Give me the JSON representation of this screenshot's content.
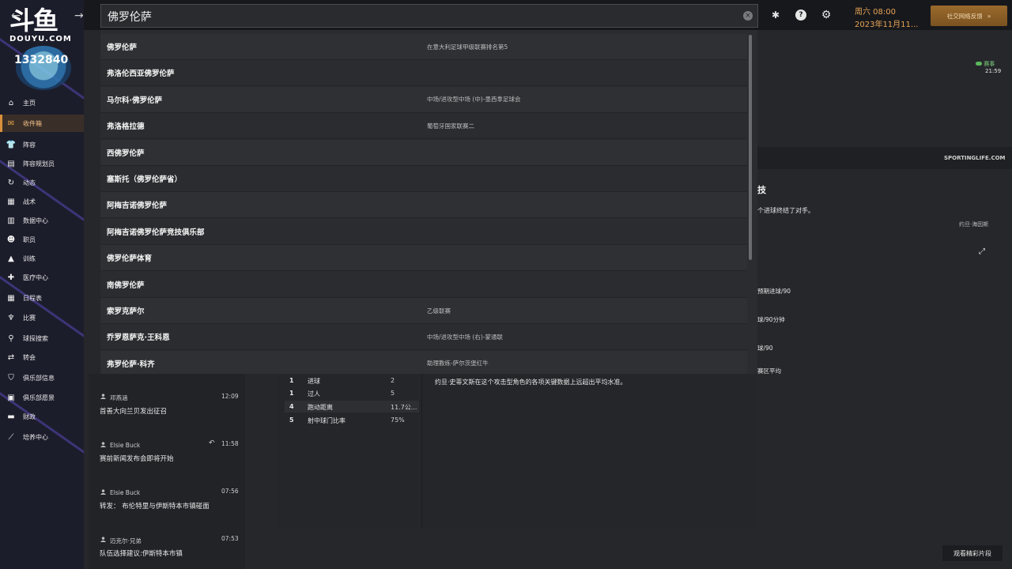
{
  "brand": {
    "logo_text": "斗鱼",
    "logo_sub": "DOUYU.COM",
    "room_number": "1332840"
  },
  "sidebar": {
    "items": [
      {
        "label": "主页",
        "icon": "home-icon",
        "glyph": "⌂"
      },
      {
        "label": "收件箱",
        "icon": "inbox-icon",
        "glyph": "✉",
        "active": true
      },
      {
        "label": "阵容",
        "icon": "shirt-icon",
        "glyph": "👕"
      },
      {
        "label": "阵容规划员",
        "icon": "clipboard-icon",
        "glyph": "▤"
      },
      {
        "label": "动态",
        "icon": "refresh-icon",
        "glyph": "↻"
      },
      {
        "label": "战术",
        "icon": "tactics-icon",
        "glyph": "▦"
      },
      {
        "label": "数据中心",
        "icon": "data-icon",
        "glyph": "▥"
      },
      {
        "label": "职员",
        "icon": "staff-icon",
        "glyph": "☻"
      },
      {
        "label": "训练",
        "icon": "training-icon",
        "glyph": "▲"
      },
      {
        "label": "医疗中心",
        "icon": "medical-icon",
        "glyph": "✚"
      },
      {
        "label": "日程表",
        "icon": "calendar-icon",
        "glyph": "▦"
      },
      {
        "label": "比赛",
        "icon": "trophy-icon",
        "glyph": "♆"
      },
      {
        "label": "球探搜索",
        "icon": "search-icon",
        "glyph": "⚲"
      },
      {
        "label": "转会",
        "icon": "transfer-icon",
        "glyph": "⇄"
      },
      {
        "label": "俱乐部信息",
        "icon": "shield-icon",
        "glyph": "⛉"
      },
      {
        "label": "俱乐部愿景",
        "icon": "vision-icon",
        "glyph": "▣"
      },
      {
        "label": "财政",
        "icon": "finance-icon",
        "glyph": "▬"
      },
      {
        "label": "培养中心",
        "icon": "development-icon",
        "glyph": "⟋"
      }
    ]
  },
  "search": {
    "value": "佛罗伦萨",
    "results": [
      {
        "name": "佛罗伦萨",
        "desc": "在意大利足球甲级联赛排名第5"
      },
      {
        "name": "弗洛伦西亚佛罗伦萨",
        "desc": ""
      },
      {
        "name": "马尔科·佛罗伦萨",
        "desc": "中场/进攻型中场 (中)-墨西拿足球会"
      },
      {
        "name": "弗洛格拉德",
        "desc": "葡萄牙国家联赛二"
      },
      {
        "name": "西佛罗伦萨",
        "desc": ""
      },
      {
        "name": "塞斯托（佛罗伦萨省）",
        "desc": ""
      },
      {
        "name": "阿梅吉诺佛罗伦萨",
        "desc": ""
      },
      {
        "name": "阿梅吉诺佛罗伦萨竞技俱乐部",
        "desc": ""
      },
      {
        "name": "佛罗伦萨体育",
        "desc": ""
      },
      {
        "name": "南佛罗伦萨",
        "desc": ""
      },
      {
        "name": "索罗克萨尔",
        "desc": "乙级联赛"
      },
      {
        "name": "乔罗恩萨克·王科恩",
        "desc": "中场/进攻型中场 (右)-蒙通联"
      },
      {
        "name": "弗罗伦萨·科齐",
        "desc": "助理教练-萨尔茨堡红牛"
      }
    ]
  },
  "topbar": {
    "date_line1": "周六 08:00",
    "date_line2": "2023年11月11...",
    "social_button": "社交网络反馈",
    "social_chevron": "»"
  },
  "right_panel": {
    "match_label": "赛事",
    "match_time": "21:59",
    "source": "SPORTINGLIFE.COM",
    "headline_tail": "技",
    "summary_tail": "个进球终结了对手。",
    "author": "约旦·海因斯",
    "stats_labels": [
      "预期进球/90",
      "球/90分钟",
      "球/90",
      "赛区平均"
    ],
    "expand_icon": "⤢"
  },
  "messages": [
    {
      "sender": "邓燕涵",
      "time": "12:09",
      "text": "首善大向兰贝发出征召",
      "reply": false
    },
    {
      "sender": "Elsie Buck",
      "time": "11:58",
      "text": "赛前新闻发布会即将开始",
      "reply": true
    },
    {
      "sender": "Elsie Buck",
      "time": "07:56",
      "text": "转发： 布伦特里与伊斯特本市镇碰面",
      "reply": false
    },
    {
      "sender": "迈克尔·兄弟",
      "time": "07:53",
      "text": "队伍选择建议:伊斯特本市镇",
      "reply": false
    }
  ],
  "stats": [
    {
      "rank": "1",
      "label": "进球",
      "value": "2"
    },
    {
      "rank": "1",
      "label": "过人",
      "value": "5"
    },
    {
      "rank": "4",
      "label": "跑动距离",
      "value": "11.7公..."
    },
    {
      "rank": "5",
      "label": "射中球门比率",
      "value": "75%"
    }
  ],
  "article_text": "约旦·史蒂文斯在这个攻击型角色的各项关键数据上远超出平均水准。",
  "watch_button": "观看精彩片段"
}
